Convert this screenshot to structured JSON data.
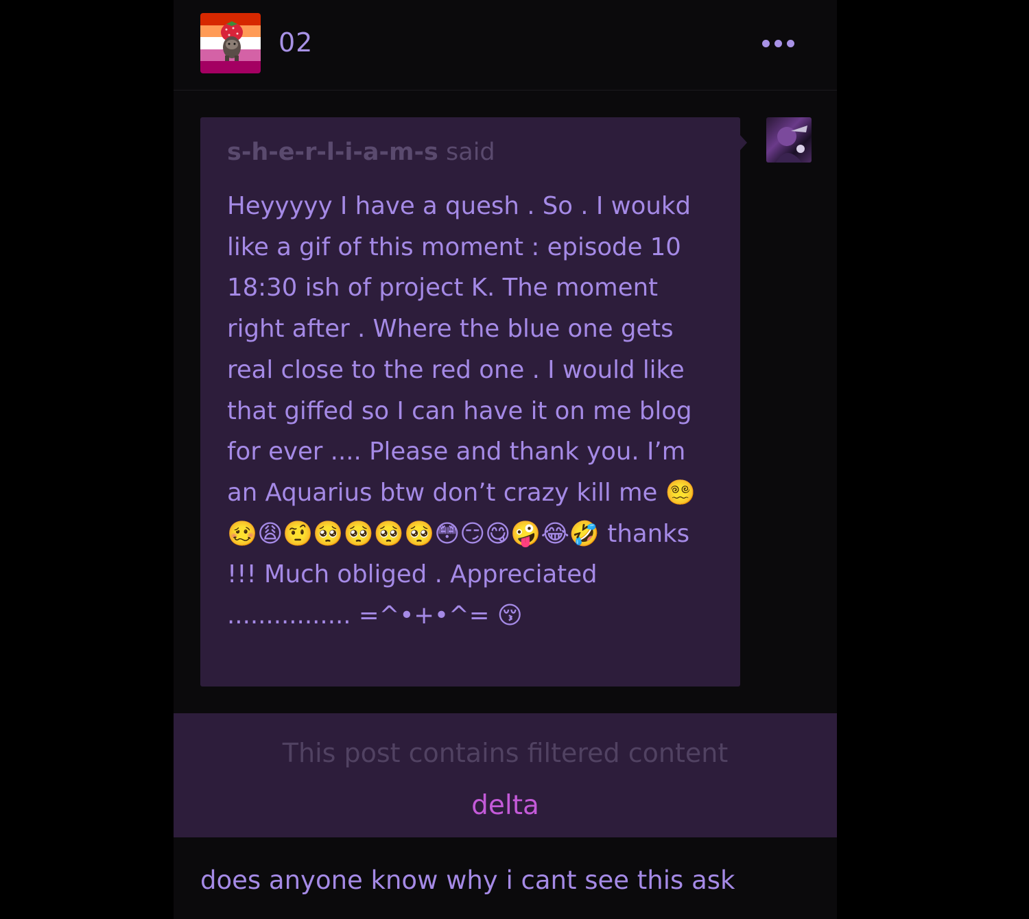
{
  "post": {
    "username": "02",
    "more_icon": "ellipsis-icon",
    "avatar_colors": [
      "#d62800",
      "#ff9b56",
      "#ffffff",
      "#d462a6",
      "#a40062"
    ]
  },
  "ask": {
    "asker": "s-h-e-r-l-i-a-m-s",
    "said": "said",
    "question": "Heyyyyy I have a quesh . So . I woukd like a gif of this moment : episode 10 18:30 ish of project K. The moment right after . Where the blue one gets real close to the red one . I would like that giffed so I can have it on me blog for ever .... Please and thank you. I’m an Aquarius btw don’t crazy kill me 😵‍💫🥴😩🤨🥺🥺🥺🥺😳😏😋🤪😂🤣 thanks !!! Much obliged . Appreciated ................ =^•+•^= 😚"
  },
  "filter": {
    "message": "This post contains filtered content",
    "tag": "delta"
  },
  "caption": "does anyone know why i cant see this ask",
  "colors": {
    "background": "#000000",
    "post_bg": "#0b0a0c",
    "box_bg": "#2d1d3b",
    "text_purple": "#a58ae6",
    "tag_pink": "#c35ad8"
  }
}
